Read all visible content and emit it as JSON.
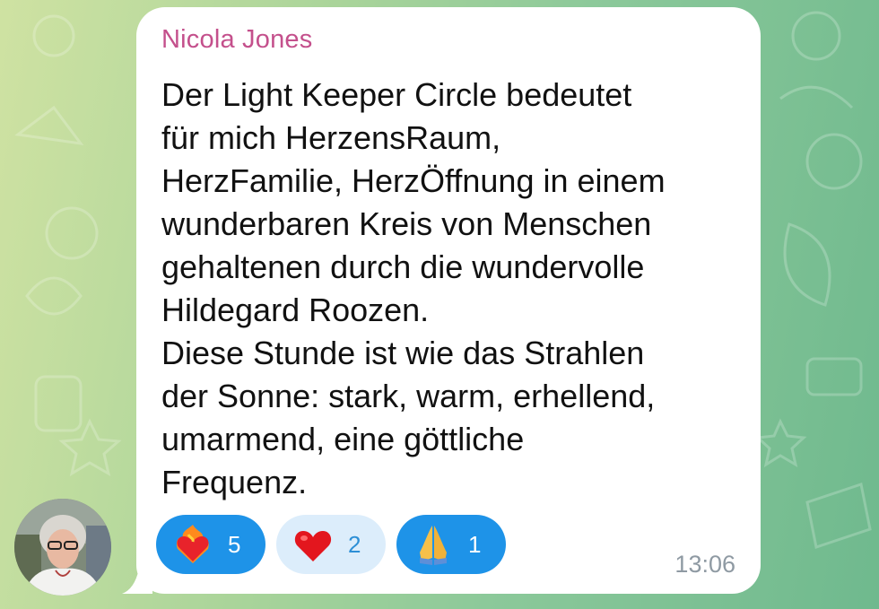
{
  "message": {
    "sender": "Nicola Jones",
    "lines_p1": [
      "Der Light Keeper Circle bedeutet",
      "für mich HerzensRaum,",
      "HerzFamilie, HerzÖffnung in einem",
      "wunderbaren Kreis von Menschen",
      "gehaltenen durch die wundervolle",
      "Hildegard Roozen."
    ],
    "lines_p2": [
      "Diese Stunde ist wie das Strahlen",
      "der Sonne: stark, warm, erhellend,",
      "umarmend, eine göttliche",
      "Frequenz."
    ],
    "time": "13:06"
  },
  "reactions": [
    {
      "icon": "heart-on-fire-icon",
      "count": "5",
      "selected": true
    },
    {
      "icon": "red-heart-icon",
      "count": "2",
      "selected": false
    },
    {
      "icon": "folded-hands-icon",
      "count": "1",
      "selected": true
    }
  ],
  "colors": {
    "sender": "#c4508c",
    "reaction_active": "#1e93e8",
    "reaction_inactive": "#dcedfb",
    "time": "#8f9aa3"
  }
}
